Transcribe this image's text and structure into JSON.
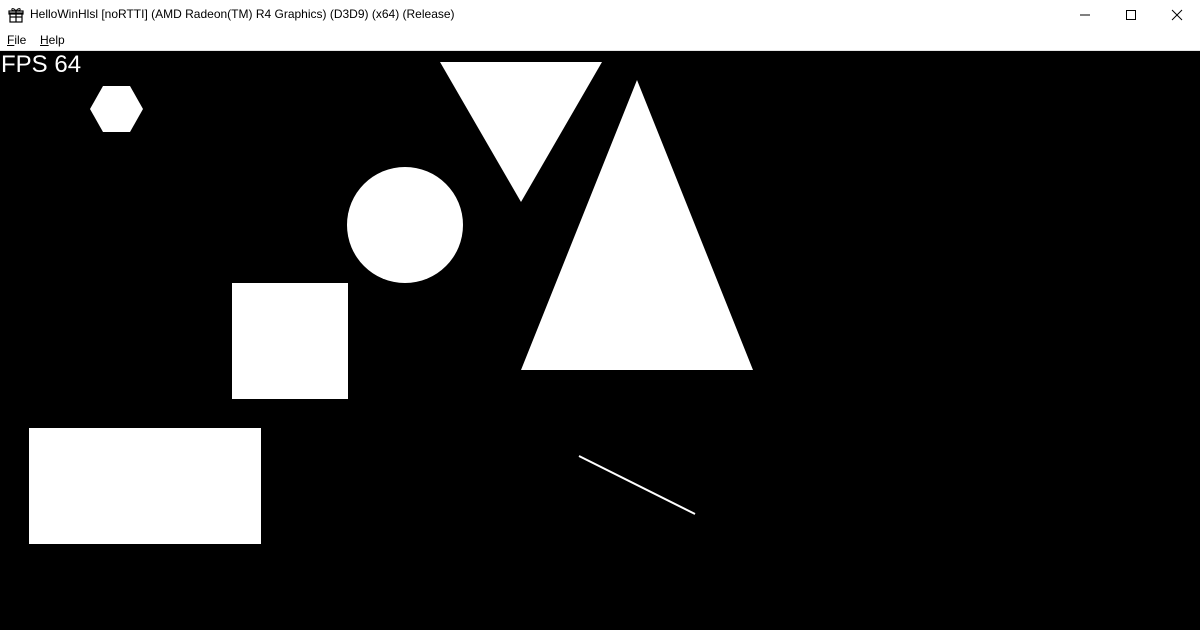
{
  "window": {
    "title": "HelloWinHlsl [noRTTI] (AMD Radeon(TM) R4 Graphics) (D3D9) (x64) (Release)",
    "app_icon": "gift-box-icon",
    "controls": {
      "minimize": "minimize-icon",
      "maximize": "maximize-icon",
      "close": "close-icon"
    }
  },
  "menubar": {
    "items": [
      {
        "accel": "F",
        "rest": "ile"
      },
      {
        "accel": "H",
        "rest": "elp"
      }
    ]
  },
  "viewport": {
    "background": "#000000",
    "shape_color": "#ffffff",
    "fps_label": "FPS 64",
    "shapes": [
      "hexagon",
      "inverted-triangle",
      "circle",
      "triangle",
      "square",
      "rectangle",
      "line"
    ]
  }
}
